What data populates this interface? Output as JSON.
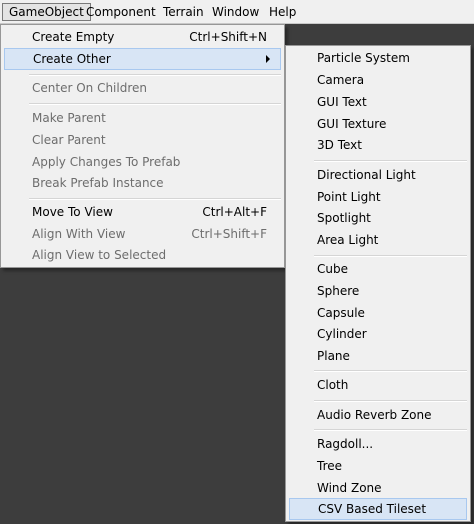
{
  "menubar": {
    "items": [
      "GameObject",
      "Component",
      "Terrain",
      "Window",
      "Help"
    ]
  },
  "main_menu": {
    "items": [
      {
        "label": "Create Empty",
        "shortcut": "Ctrl+Shift+N",
        "enabled": true
      },
      {
        "label": "Create Other",
        "shortcut": "",
        "enabled": true,
        "submenu": true
      },
      {
        "label": "Center On Children",
        "shortcut": "",
        "enabled": false
      },
      {
        "label": "Make Parent",
        "shortcut": "",
        "enabled": false
      },
      {
        "label": "Clear Parent",
        "shortcut": "",
        "enabled": false
      },
      {
        "label": "Apply Changes To Prefab",
        "shortcut": "",
        "enabled": false
      },
      {
        "label": "Break Prefab Instance",
        "shortcut": "",
        "enabled": false
      },
      {
        "label": "Move To View",
        "shortcut": "Ctrl+Alt+F",
        "enabled": true
      },
      {
        "label": "Align With View",
        "shortcut": "Ctrl+Shift+F",
        "enabled": false
      },
      {
        "label": "Align View to Selected",
        "shortcut": "",
        "enabled": false
      }
    ]
  },
  "sub_menu": {
    "items": [
      "Particle System",
      "Camera",
      "GUI Text",
      "GUI Texture",
      "3D Text",
      "Directional Light",
      "Point Light",
      "Spotlight",
      "Area Light",
      "Cube",
      "Sphere",
      "Capsule",
      "Cylinder",
      "Plane",
      "Cloth",
      "Audio Reverb Zone",
      "Ragdoll...",
      "Tree",
      "Wind Zone",
      "CSV Based Tileset"
    ]
  },
  "colors": {
    "menu_bg": "#f0f0f0",
    "highlight_bg": "#d8e5f5",
    "highlight_border": "#a8c8ef",
    "disabled_text": "#6d6d6d",
    "backdrop": "#3d3d3d"
  }
}
